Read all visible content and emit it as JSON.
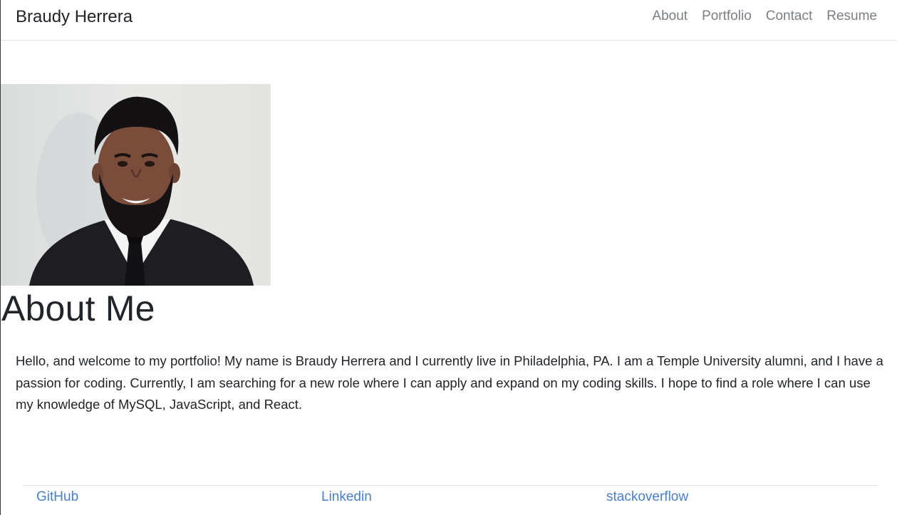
{
  "header": {
    "brand": "Braudy Herrera",
    "nav": [
      "About",
      "Portfolio",
      "Contact",
      "Resume"
    ]
  },
  "main": {
    "heading": "About Me",
    "bio": "Hello, and welcome to my portfolio! My name is Braudy Herrera and I currently live in Philadelphia, PA. I am a Temple University alumni, and I have a passion for coding. Currently, I am searching for a new role where I can apply and expand on my coding skills. I hope to find a role where I can use my knowledge of MySQL, JavaScript, and React."
  },
  "footer": {
    "links": [
      "GitHub",
      "Linkedin",
      "stackoverflow"
    ]
  },
  "colors": {
    "text": "#212529",
    "nav_link": "#7a7f84",
    "footer_link": "#4a7fd0",
    "border": "#dee2e6"
  }
}
